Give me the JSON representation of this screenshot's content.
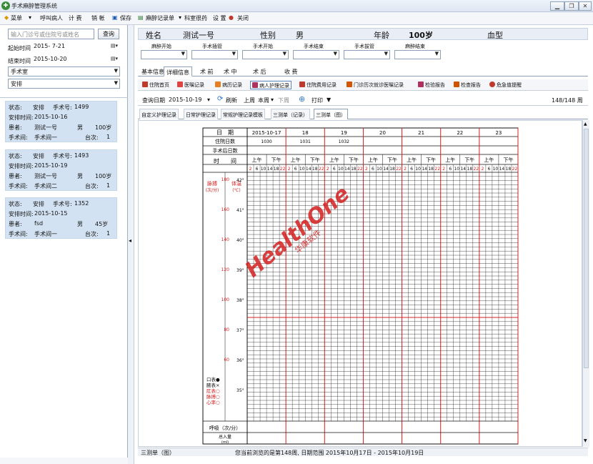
{
  "window": {
    "title": "手术麻醉管理系统"
  },
  "menu": [
    "菜单",
    "呼叫病人",
    "计 费",
    "销 帐",
    "保存",
    "麻醉记录单",
    "科室很药",
    "设 置",
    "关闭"
  ],
  "left": {
    "search_placeholder": "输入门诊号或住院号或姓名",
    "search_btn": "查询",
    "start_label": "起始时间",
    "start_value": "2015- 7-21",
    "end_label": "结束时间",
    "end_value": "2015-10-20",
    "filter1": "手术室",
    "filter2": "安排",
    "cards": [
      {
        "status_label": "状态:",
        "status": "安排",
        "no_label": "手术号:",
        "no": "1499",
        "time_label": "安排时间:",
        "time": "2015-10-16",
        "patient_label": "患者:",
        "patient": "测试一号",
        "sex": "男",
        "age": "100岁",
        "room_label": "手术间:",
        "room": "手术间一",
        "seq_label": "台次:",
        "seq": "1"
      },
      {
        "status_label": "状态:",
        "status": "安排",
        "no_label": "手术号:",
        "no": "1493",
        "time_label": "安排时间:",
        "time": "2015-10-19",
        "patient_label": "患者:",
        "patient": "测试一号",
        "sex": "男",
        "age": "100岁",
        "room_label": "手术间:",
        "room": "手术间二",
        "seq_label": "台次:",
        "seq": "1"
      },
      {
        "status_label": "状态:",
        "status": "安排",
        "no_label": "手术号:",
        "no": "1352",
        "time_label": "安排时间:",
        "time": "2015-10-15",
        "patient_label": "患者:",
        "patient": "fsd",
        "sex": "男",
        "age": "45岁",
        "room_label": "手术间:",
        "room": "手术间一",
        "seq_label": "台次:",
        "seq": "1"
      }
    ]
  },
  "info": {
    "name_label": "姓名",
    "name": "测试一号",
    "sex_label": "性别",
    "sex": "男",
    "age_label": "年龄",
    "age": "100岁",
    "blood_label": "血型"
  },
  "times": [
    "麻醉开始",
    "手术插管",
    "手术开始",
    "手术结束",
    "手术拔管",
    "麻醉结束"
  ],
  "tabs": [
    "基本信息",
    "详细信息",
    "术 前",
    "术 中",
    "术 后",
    "收 费"
  ],
  "subtabs": [
    "住院首页",
    "医嘱记录",
    "病历记录",
    "病人护理记录",
    "住院费用记录",
    "门诊历次就诊医嘱记录",
    "检验报告",
    "检查报告",
    "危急值提醒"
  ],
  "toolbar": {
    "date_label": "查询日期",
    "date_value": "2015-10-19",
    "refresh": "刷新",
    "prev": "上周",
    "cur": "本周",
    "next": "下周",
    "print": "打印",
    "page": "148/148 周"
  },
  "tabs2": [
    "自定义护理记录",
    "日常护理记录",
    "常规护理记录模板",
    "三测单（记录）",
    "三测单（图）"
  ],
  "sheet": {
    "date_label": "日　期",
    "hosp_label": "住院日数",
    "postop_label": "手术后日数",
    "time_label": "时　　间",
    "dates": [
      "2015-10-17",
      "18",
      "19",
      "20",
      "21",
      "22",
      "23"
    ],
    "hosp_days": [
      "1030",
      "1031",
      "1032",
      "",
      "",
      "",
      ""
    ],
    "am": "上午",
    "pm": "下午",
    "hours": [
      "2",
      "6",
      "10",
      "14",
      "18",
      "22"
    ],
    "pulse_label": "脉搏\n(次/分)",
    "temp_label": "体温\n(℃)",
    "pulse_ticks": [
      "180",
      "160",
      "140",
      "120",
      "100",
      "80",
      "60"
    ],
    "temp_ticks": [
      "42°",
      "41°",
      "40°",
      "39°",
      "38°",
      "37°",
      "36°",
      "35°"
    ],
    "legend": [
      "口表●",
      "腋表×",
      "肛表○",
      "脉搏○",
      "心率○"
    ],
    "breath_label": "呼吸（次/分）",
    "intake_label": "总入量\n(ml)"
  },
  "watermark": {
    "brand": "HealthOne",
    "cn": "华康软件"
  },
  "status": {
    "left": "三测单（图）",
    "right": "您当前浏览的是第148周, 日期范围 2015年10月17日 - 2015年10月19日"
  },
  "colors": {
    "grid_red": "#d42020",
    "card_bg": "#d3e2f2"
  }
}
